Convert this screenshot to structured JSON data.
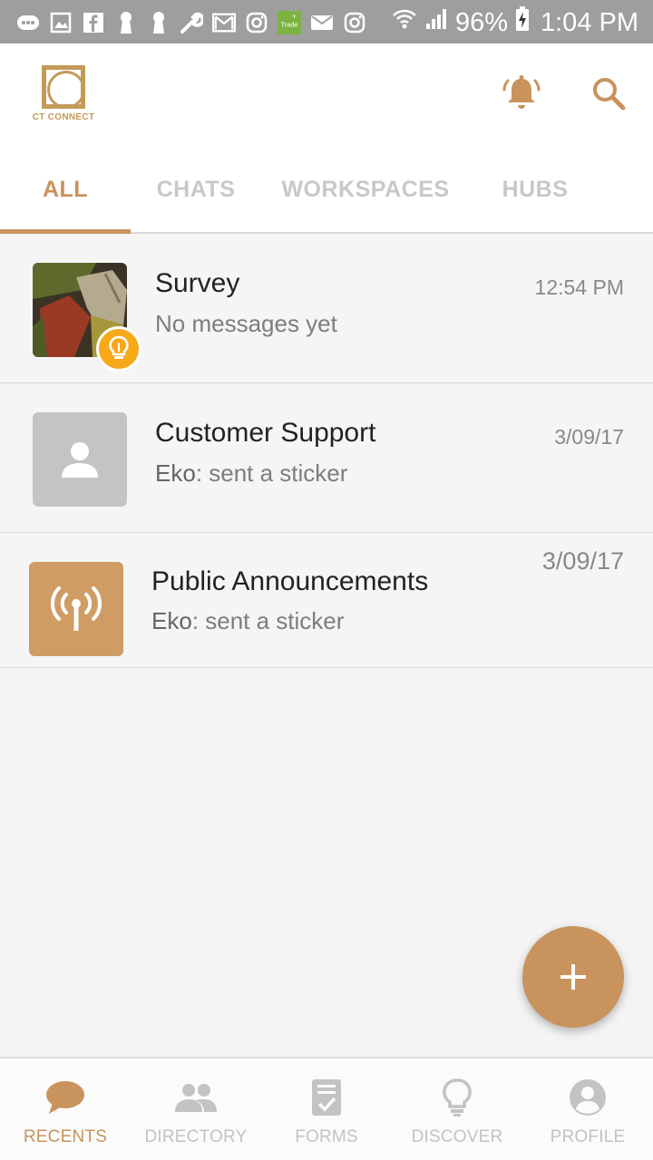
{
  "status_bar": {
    "icons": [
      "messages-icon",
      "gallery-icon",
      "facebook-icon",
      "keyhole-icon",
      "keyhole-icon",
      "wrench-icon",
      "gmail-icon",
      "instagram-icon",
      "trade-app-icon",
      "mail-icon",
      "instagram-icon"
    ],
    "trade_label": "Trade",
    "battery_percent": "96%",
    "time": "1:04 PM"
  },
  "header": {
    "logo_text": "CT CONNECT",
    "notifications_icon": "bell-icon",
    "search_icon": "search-icon"
  },
  "tabs": [
    {
      "label": "ALL",
      "active": true
    },
    {
      "label": "CHATS",
      "active": false
    },
    {
      "label": "WORKSPACES",
      "active": false
    },
    {
      "label": "HUBS",
      "active": false
    }
  ],
  "conversations": [
    {
      "title": "Survey",
      "subtitle": "No messages yet",
      "time": "12:54 PM",
      "avatar": "survey-image",
      "badge": "lightbulb-icon"
    },
    {
      "title": "Customer Support",
      "sender": "Eko",
      "message": ": sent a sticker",
      "time": "3/09/17",
      "avatar": "person-icon"
    },
    {
      "title": "Public Announcements",
      "sender": "Eko",
      "message": ": sent a sticker",
      "time": "3/09/17",
      "avatar": "broadcast-icon"
    }
  ],
  "fab": {
    "icon": "plus-icon"
  },
  "bottom_nav": [
    {
      "label": "RECENTS",
      "icon": "chat-bubble-icon",
      "active": true
    },
    {
      "label": "DIRECTORY",
      "icon": "people-icon",
      "active": false
    },
    {
      "label": "FORMS",
      "icon": "form-icon",
      "active": false
    },
    {
      "label": "DISCOVER",
      "icon": "lightbulb-icon",
      "active": false
    },
    {
      "label": "PROFILE",
      "icon": "profile-icon",
      "active": false
    }
  ],
  "colors": {
    "accent": "#c8935d",
    "logo": "#c49a58",
    "badge": "#f8a91a",
    "status_bar": "#9e9e9e",
    "inactive": "#c3c3c3"
  }
}
